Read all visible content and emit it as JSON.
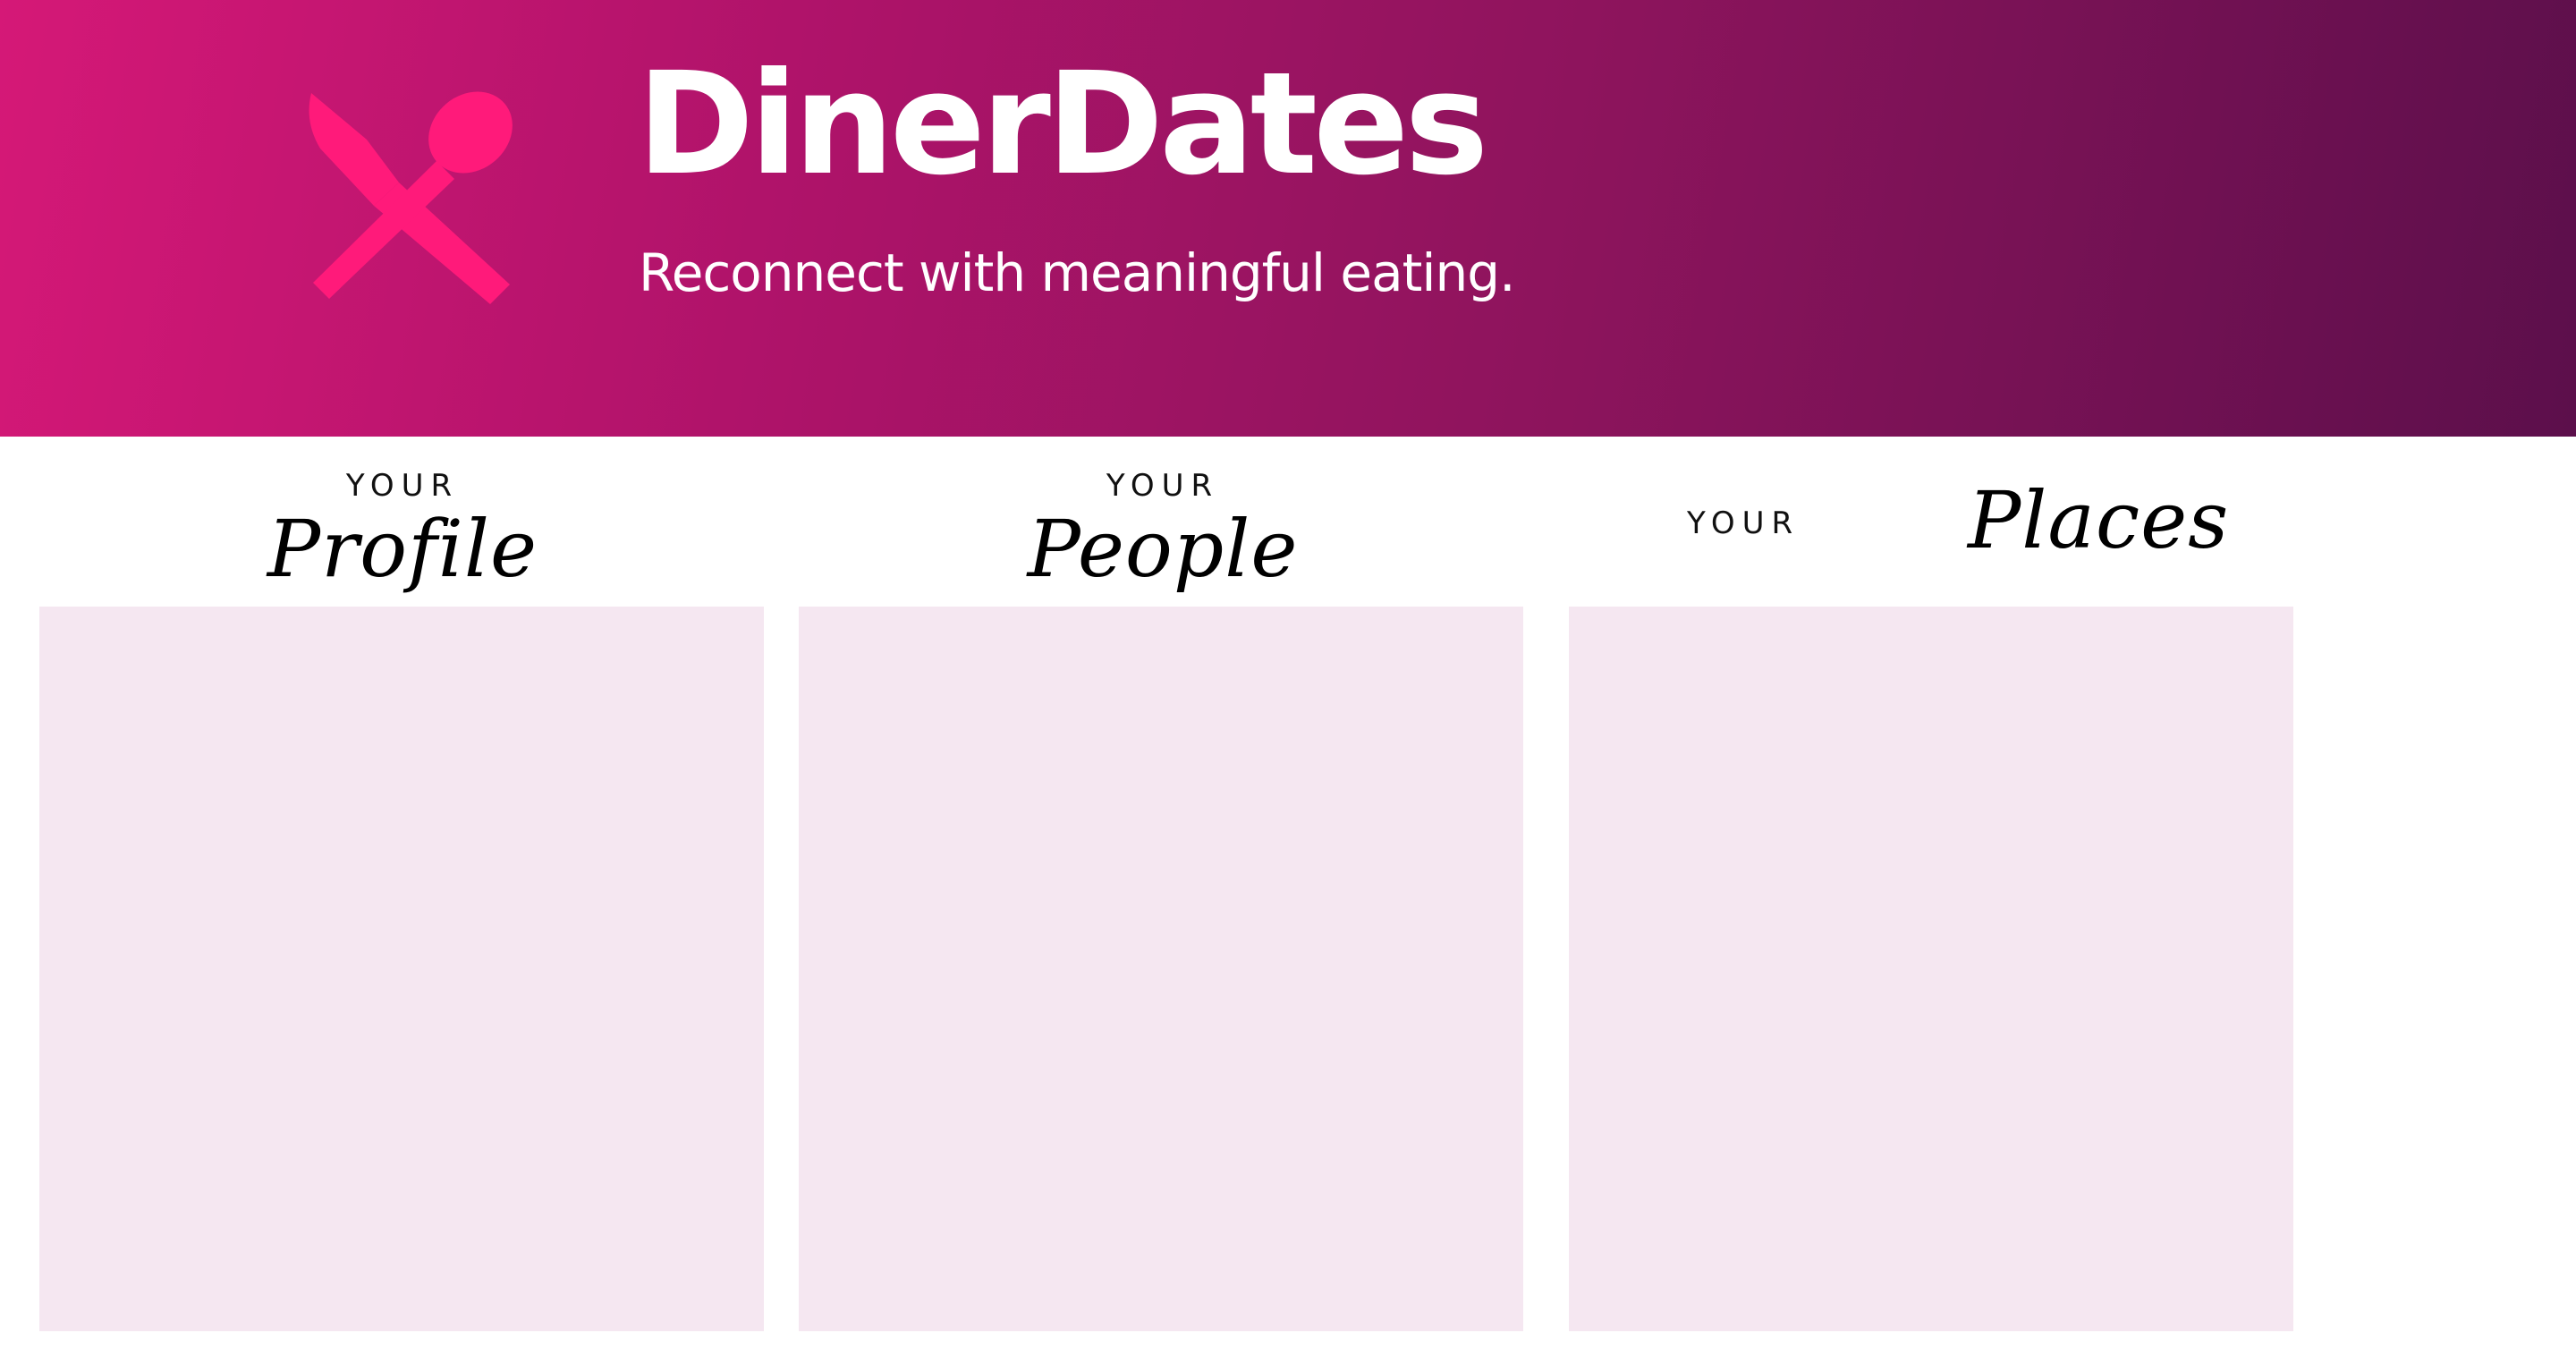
{
  "app": {
    "title": "DinerDates",
    "tagline": "Reconnect with meaningful eating."
  },
  "logo": {
    "icon": "fork-spoon-crossed-icon",
    "color": "#ff1a7a"
  },
  "header": {
    "gradient_start": "#d51877",
    "gradient_end": "#5c0f4b"
  },
  "sections": [
    {
      "prefix": "YOUR",
      "title": "Profile"
    },
    {
      "prefix": "YOUR",
      "title": "People"
    },
    {
      "prefix": "YOUR",
      "title": "Places"
    }
  ],
  "panel_color": "#f5e7f1"
}
